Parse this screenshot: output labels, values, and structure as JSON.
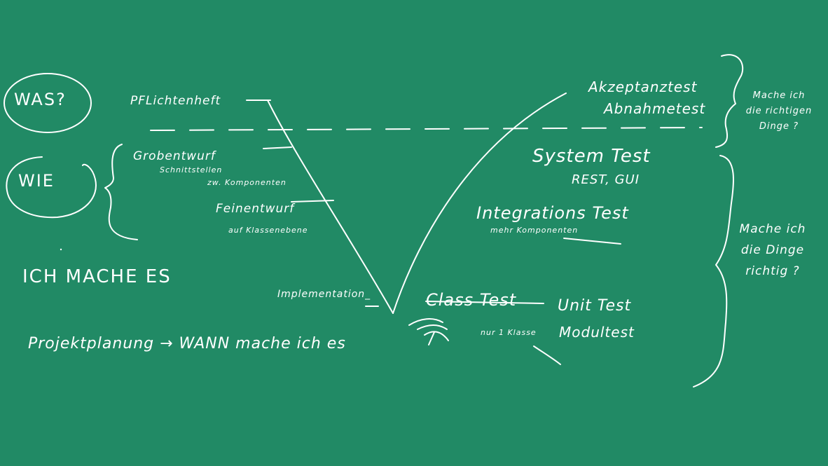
{
  "labels": {
    "was": "WAS?",
    "wie": "WIE",
    "ich_mache_es": "ICH MACHE ES",
    "projektplanung": "Projektplanung → WANN mache ich es",
    "pflichtenheft": "PFLichtenheft",
    "grobentwurf": "Grobentwurf",
    "schnittstellen": "Schnittstellen",
    "zw_komponenten": "zw. Komponenten",
    "feinentwurf": "Feinentwurf",
    "auf_klassenebene": "auf Klassenebene",
    "implementation": "Implementation_",
    "akzeptanztest": "Akzeptanztest",
    "abnahmetest": "Abnahmetest",
    "systemtest": "System Test",
    "rest_gui": "REST, GUI",
    "integrationstest": "Integrations Test",
    "mehr_komponenten": "mehr Komponenten",
    "classtest": "Class Test",
    "unittest": "Unit Test",
    "modultest": "Modultest",
    "nur_1_klasse": "nur 1 Klasse",
    "mache_ich_die_richtigen": "Mache ich die richtigen Dinge ?",
    "mache_ich_die_dinge_richtig": "Mache ich die Dinge richtig ?"
  },
  "colors": {
    "board": "#218a65",
    "chalk": "#ffffff"
  }
}
